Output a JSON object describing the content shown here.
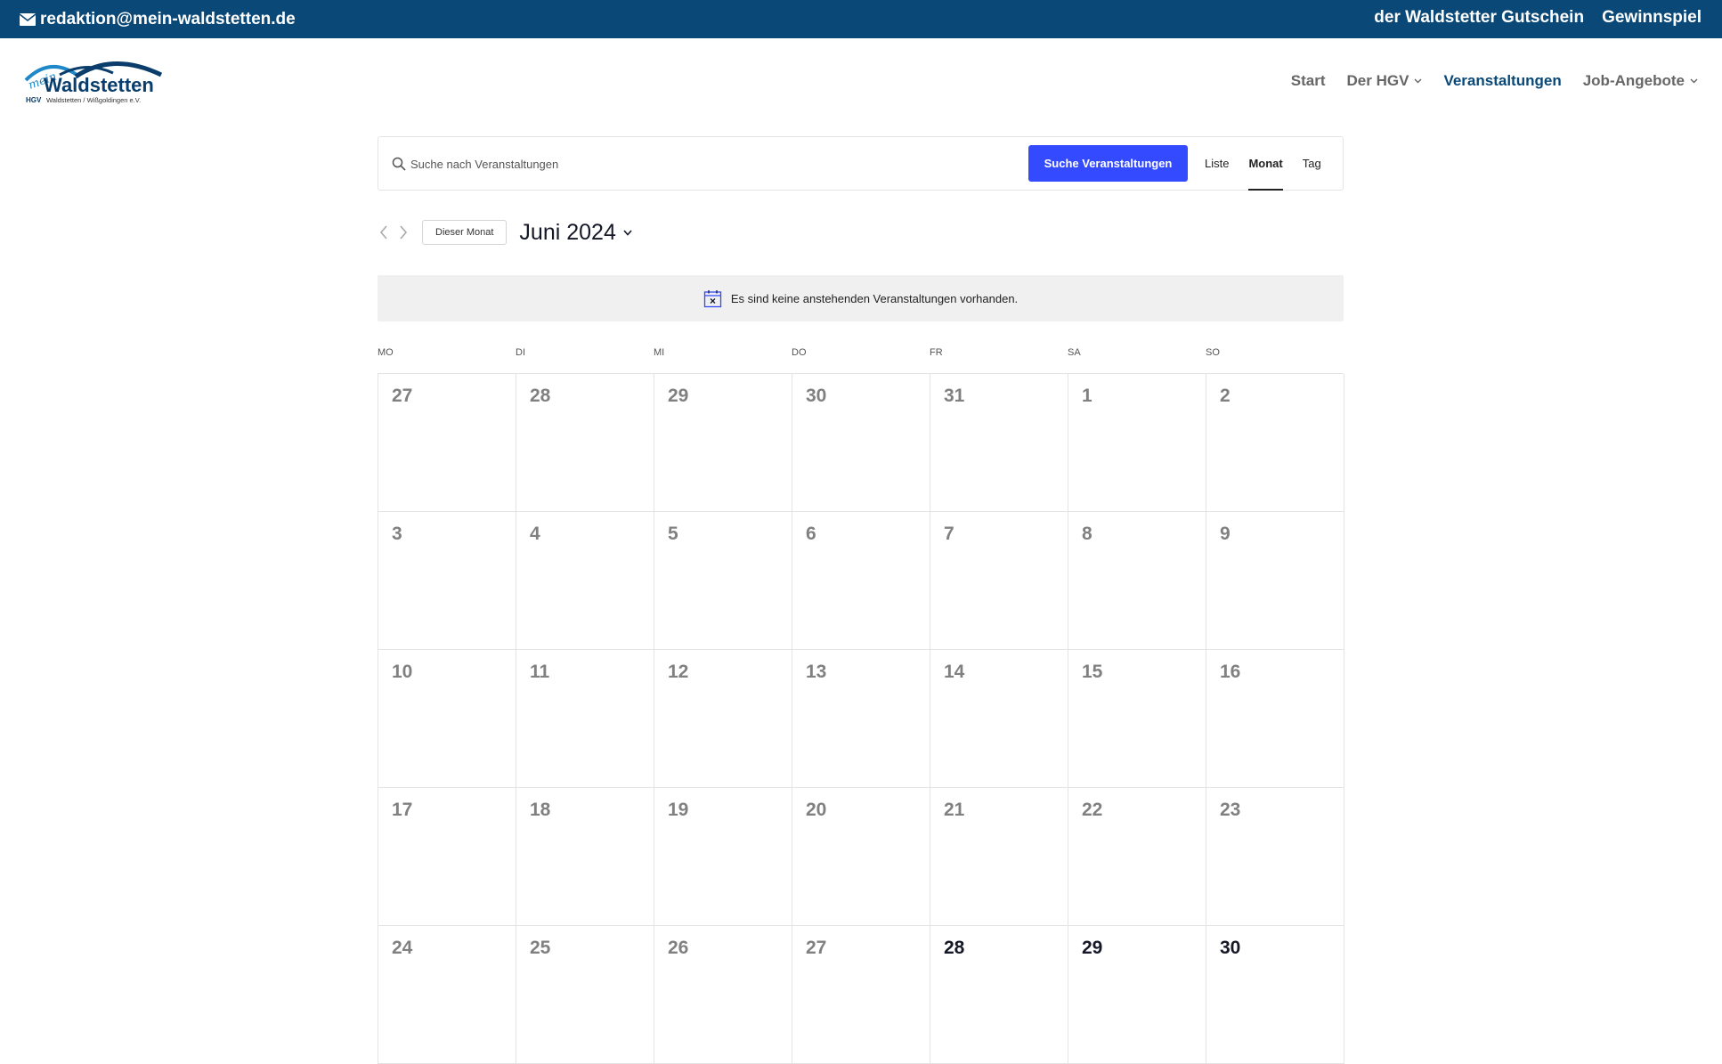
{
  "topbar": {
    "email": "redaktion@mein-waldstetten.de",
    "links": [
      "der Waldstetter Gutschein",
      "Gewinnspiel"
    ],
    "bg_color": "#0a4877"
  },
  "logo": {
    "script": "mein",
    "name": "Waldstetten",
    "abbr": "HGV",
    "subtitle": "Waldstetten / Wißgoldingen e.V."
  },
  "nav": {
    "items": [
      {
        "label": "Start",
        "active": false,
        "dropdown": false
      },
      {
        "label": "Der HGV",
        "active": false,
        "dropdown": true
      },
      {
        "label": "Veranstaltungen",
        "active": true,
        "dropdown": false
      },
      {
        "label": "Job-Angebote",
        "active": false,
        "dropdown": true
      }
    ]
  },
  "search": {
    "placeholder": "Suche nach Veranstaltungen",
    "button_label": "Suche Veranstaltungen",
    "button_color": "#334aff",
    "views": [
      {
        "label": "Liste",
        "active": false
      },
      {
        "label": "Monat",
        "active": true
      },
      {
        "label": "Tag",
        "active": false
      }
    ]
  },
  "month_nav": {
    "today_label": "Dieser Monat",
    "title": "Juni 2024"
  },
  "notice": {
    "text": "Es sind keine anstehenden Veranstaltungen vorhanden."
  },
  "calendar": {
    "weekdays": [
      "MO",
      "DI",
      "MI",
      "DO",
      "FR",
      "SA",
      "SO"
    ],
    "days": [
      {
        "day": "27",
        "upcoming": false
      },
      {
        "day": "28",
        "upcoming": false
      },
      {
        "day": "29",
        "upcoming": false
      },
      {
        "day": "30",
        "upcoming": false
      },
      {
        "day": "31",
        "upcoming": false
      },
      {
        "day": "1",
        "upcoming": false
      },
      {
        "day": "2",
        "upcoming": false
      },
      {
        "day": "3",
        "upcoming": false
      },
      {
        "day": "4",
        "upcoming": false
      },
      {
        "day": "5",
        "upcoming": false
      },
      {
        "day": "6",
        "upcoming": false
      },
      {
        "day": "7",
        "upcoming": false
      },
      {
        "day": "8",
        "upcoming": false
      },
      {
        "day": "9",
        "upcoming": false
      },
      {
        "day": "10",
        "upcoming": false
      },
      {
        "day": "11",
        "upcoming": false
      },
      {
        "day": "12",
        "upcoming": false
      },
      {
        "day": "13",
        "upcoming": false
      },
      {
        "day": "14",
        "upcoming": false
      },
      {
        "day": "15",
        "upcoming": false
      },
      {
        "day": "16",
        "upcoming": false
      },
      {
        "day": "17",
        "upcoming": false
      },
      {
        "day": "18",
        "upcoming": false
      },
      {
        "day": "19",
        "upcoming": false
      },
      {
        "day": "20",
        "upcoming": false
      },
      {
        "day": "21",
        "upcoming": false
      },
      {
        "day": "22",
        "upcoming": false
      },
      {
        "day": "23",
        "upcoming": false
      },
      {
        "day": "24",
        "upcoming": false
      },
      {
        "day": "25",
        "upcoming": false
      },
      {
        "day": "26",
        "upcoming": false
      },
      {
        "day": "27",
        "upcoming": false
      },
      {
        "day": "28",
        "upcoming": true
      },
      {
        "day": "29",
        "upcoming": true
      },
      {
        "day": "30",
        "upcoming": true
      }
    ]
  }
}
